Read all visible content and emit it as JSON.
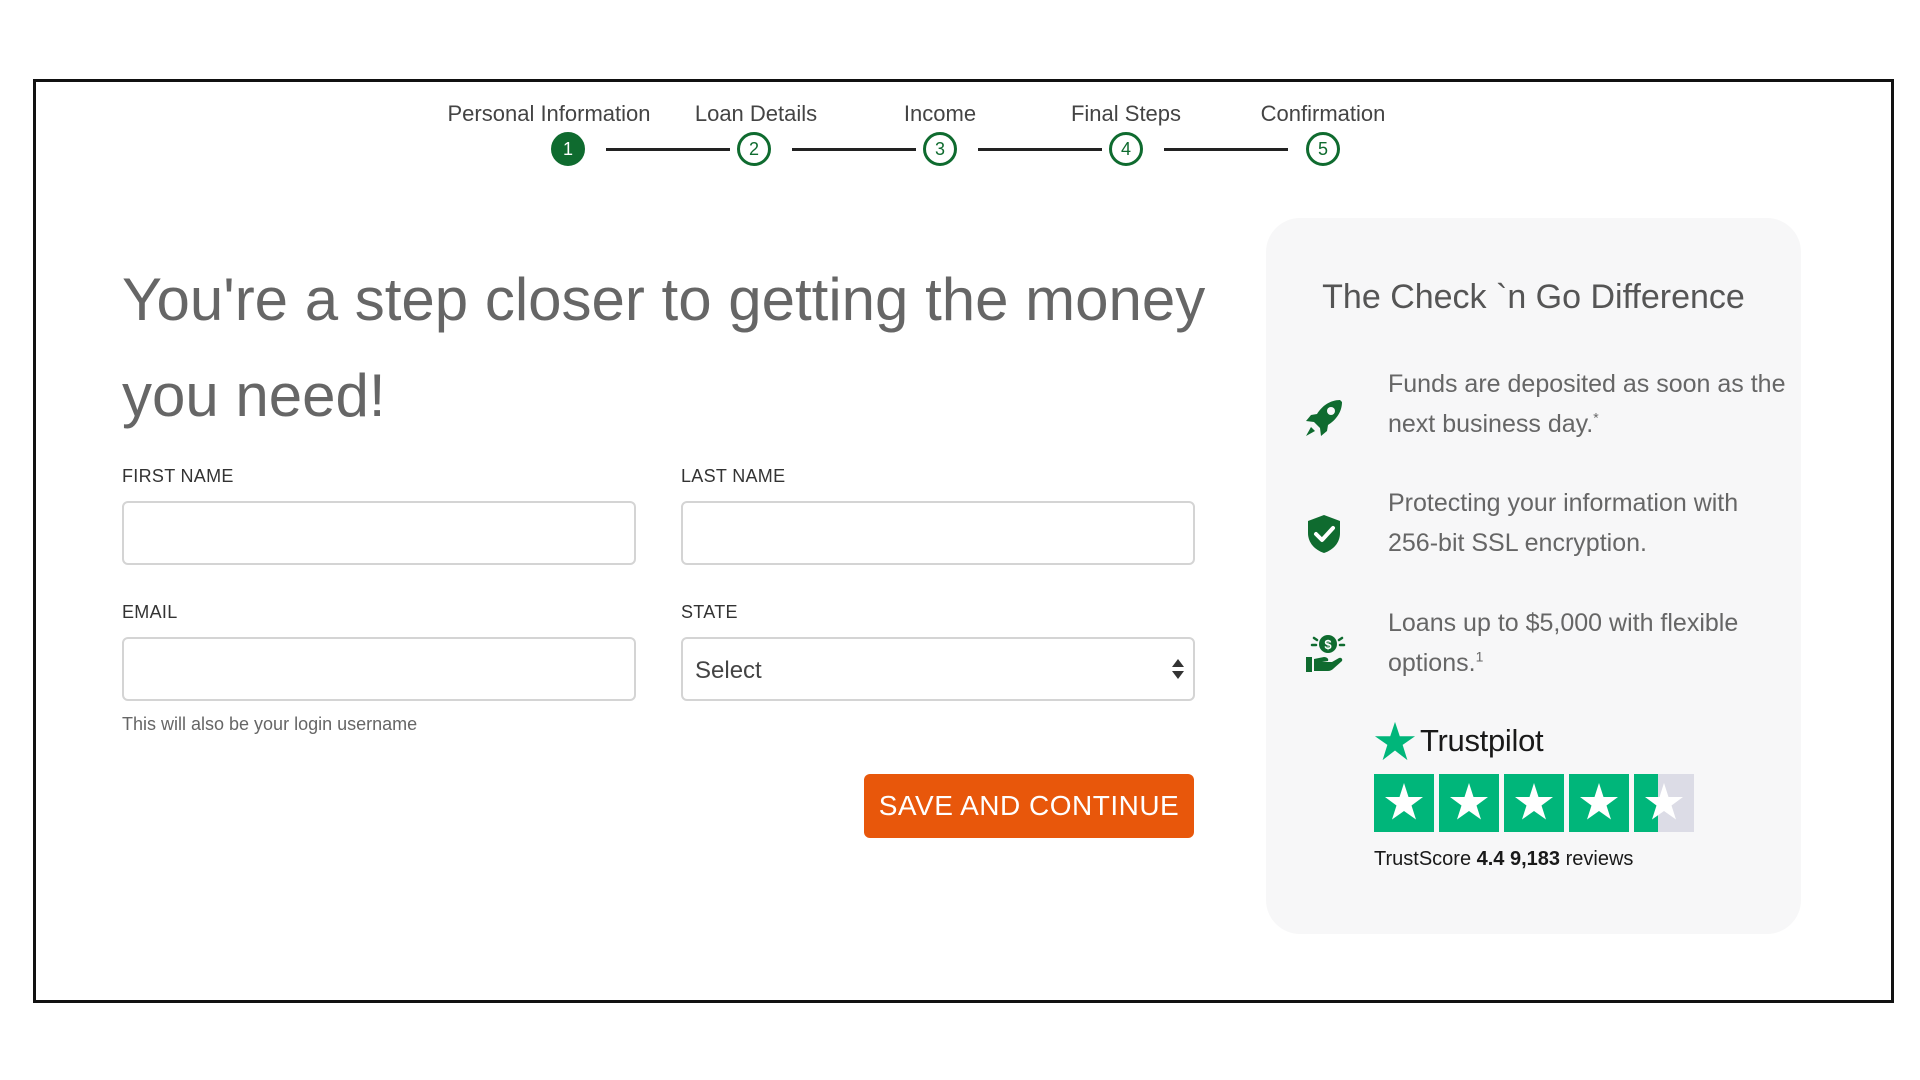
{
  "stepper": {
    "steps": [
      {
        "label": "Personal Information",
        "number": "1",
        "active": true
      },
      {
        "label": "Loan Details",
        "number": "2",
        "active": false
      },
      {
        "label": "Income",
        "number": "3",
        "active": false
      },
      {
        "label": "Final Steps",
        "number": "4",
        "active": false
      },
      {
        "label": "Confirmation",
        "number": "5",
        "active": false
      }
    ]
  },
  "headline": "You're a step closer to getting the money you need!",
  "form": {
    "first_name_label": "FIRST NAME",
    "first_name_value": "",
    "last_name_label": "LAST NAME",
    "last_name_value": "",
    "email_label": "EMAIL",
    "email_value": "",
    "email_help": "This will also be your login username",
    "state_label": "STATE",
    "state_selected": "Select",
    "save_label": "SAVE AND CONTINUE"
  },
  "card": {
    "title": "The Check `n Go Difference",
    "benefits": [
      {
        "icon": "rocket-icon",
        "text": "Funds are deposited as soon as the next business day.",
        "sup": "*"
      },
      {
        "icon": "shield-check-icon",
        "text": "Protecting your information with 256-bit SSL encryption.",
        "sup": ""
      },
      {
        "icon": "hand-money-icon",
        "text": "Loans up to $5,000 with flexible options.",
        "sup": "1"
      }
    ],
    "trustpilot": {
      "brand": "Trustpilot",
      "score_label": "TrustScore",
      "score": "4.4",
      "reviews_count": "9,183",
      "reviews_label": "reviews",
      "rating": 4.4,
      "max_rating": 5
    }
  },
  "colors": {
    "brand_green": "#0f6b2f",
    "cta_orange": "#e8570b",
    "trustpilot_green": "#00b67a"
  }
}
